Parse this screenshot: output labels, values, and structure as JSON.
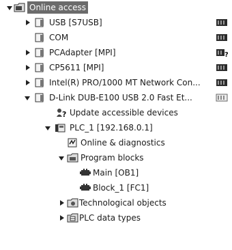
{
  "tree": {
    "root": "Online access",
    "usb": "USB [S7USB]",
    "com": "COM",
    "pcadapter": "PCAdapter [MPI]",
    "cp5611": "CP5611 [MPI]",
    "intel": "Intel(R) PRO/1000 MT Network Con...",
    "dlink": "D-Link DUB-E100 USB 2.0 Fast Et...",
    "update": "Update accessible devices",
    "plc": "PLC_1 [192.168.0.1]",
    "diag": "Online & diagnostics",
    "program_blocks": "Program blocks",
    "main": "Main [OB1]",
    "block1": "Block_1 [FC1]",
    "tech": "Technological objects",
    "plctypes": "PLC data types"
  },
  "icons": {
    "folder": "folder-icon",
    "interface": "network-interface-icon",
    "status": "connection-status-icon",
    "update": "update-devices-icon",
    "plc": "plc-icon",
    "diag": "diagnostics-icon",
    "block": "program-block-icon",
    "tech": "technology-object-icon",
    "types": "data-types-icon"
  },
  "colors": {
    "selection": "#6b6b6b",
    "icon_dark": "#2b2b2b",
    "icon_light": "#dcdcdc"
  }
}
